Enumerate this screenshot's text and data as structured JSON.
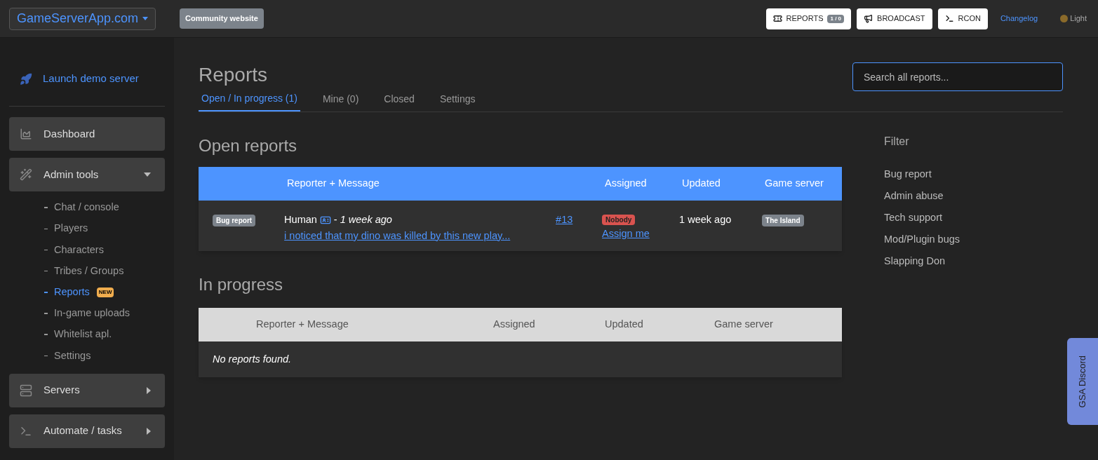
{
  "topbar": {
    "site_menu": "GameServerApp.com",
    "community_link": "Community website",
    "buttons": [
      {
        "kind": "reports",
        "label": "REPORTS",
        "badge": "1 / 0"
      },
      {
        "kind": "broadcast",
        "label": "BROADCAST"
      },
      {
        "kind": "rcon",
        "label": "RCON"
      }
    ],
    "changelog": "Changelog",
    "theme_toggle": "Light"
  },
  "sidebar": {
    "launch": "Launch demo server",
    "sections": [
      {
        "label": "Dashboard"
      },
      {
        "label": "Admin tools",
        "expanded": true,
        "children": [
          {
            "label": "Chat / console",
            "selected": false
          },
          {
            "label": "Players",
            "selected": false
          },
          {
            "label": "Characters",
            "selected": false
          },
          {
            "label": "Tribes / Groups",
            "selected": false
          },
          {
            "label": "Reports",
            "selected": true,
            "badge": "NEW"
          },
          {
            "label": "In-game uploads",
            "selected": false
          },
          {
            "label": "Whitelist apl.",
            "selected": false
          },
          {
            "label": "Settings",
            "selected": false
          }
        ]
      },
      {
        "label": "Servers",
        "expanded": false
      },
      {
        "label": "Automate / tasks",
        "expanded": false
      }
    ]
  },
  "page": {
    "title": "Reports",
    "search": {
      "placeholder": "Search all reports..."
    },
    "tabs": [
      {
        "label": "Open / In progress (1)",
        "selected": true
      },
      {
        "label": "Mine (0)",
        "selected": false
      },
      {
        "label": "Closed",
        "selected": false
      },
      {
        "label": "Settings",
        "selected": false
      }
    ],
    "open_reports": {
      "title": "Open reports",
      "columns": [
        "Reporter + Message",
        "Assigned",
        "Updated",
        "Game server"
      ],
      "rows": [
        {
          "type": "Bug report",
          "reporter": "Human",
          "separator": "-",
          "time": "1 week ago",
          "message": "i noticed that my dino was killed by this new play...",
          "id": "#13",
          "assigned": "Nobody",
          "assign_link": "Assign me",
          "updated": "1 week ago",
          "server": "The Island"
        }
      ]
    },
    "in_progress": {
      "title": "In progress",
      "columns": [
        "Reporter + Message",
        "Assigned",
        "Updated",
        "Game server"
      ],
      "empty": "No reports found."
    },
    "filter": {
      "title": "Filter",
      "items": [
        "Bug report",
        "Admin abuse",
        "Tech support",
        "Mod/Plugin bugs",
        "Slapping Don"
      ]
    }
  },
  "discord_tab": "GSA Discord"
}
